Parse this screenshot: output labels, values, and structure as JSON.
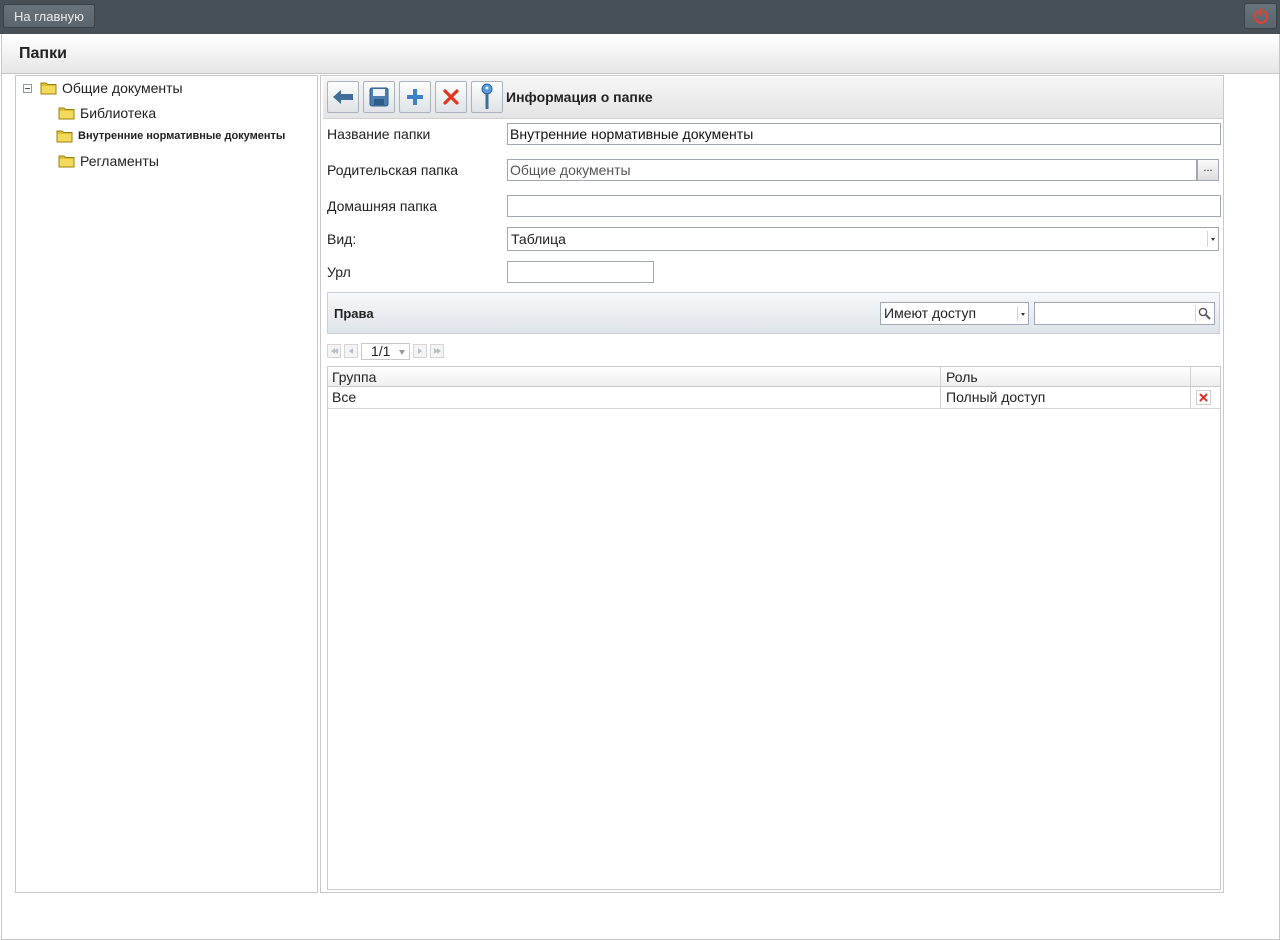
{
  "topbar": {
    "home_label": "На главную",
    "power_icon": "power-icon",
    "power_color": "#e3412f"
  },
  "window": {
    "title": "Папки"
  },
  "tree": {
    "root": {
      "label": "Общие документы"
    },
    "children": [
      {
        "label": "Библиотека",
        "selected": false
      },
      {
        "label": "Внутренние нормативные документы",
        "selected": true
      },
      {
        "label": "Регламенты",
        "selected": false
      }
    ]
  },
  "toolbar": {
    "title": "Информация о папке",
    "buttons": [
      "back-icon",
      "save-icon",
      "add-icon",
      "delete-icon",
      "key-icon"
    ]
  },
  "form": {
    "name_label": "Название папки",
    "name_value": "Внутренние нормативные документы",
    "parent_label": "Родительская папка",
    "parent_value": "Общие документы",
    "browse_label": "...",
    "home_label": "Домашняя папка",
    "home_value": "",
    "view_label": "Вид:",
    "view_value": "Таблица",
    "url_label": "Урл",
    "url_value": ""
  },
  "rights": {
    "title": "Права",
    "filter_value": "Имеют доступ",
    "search_value": "",
    "pager": {
      "page_value": "1/1"
    },
    "columns": [
      "Группа",
      "Роль"
    ],
    "rows": [
      {
        "group": "Все",
        "role": "Полный доступ"
      }
    ]
  }
}
